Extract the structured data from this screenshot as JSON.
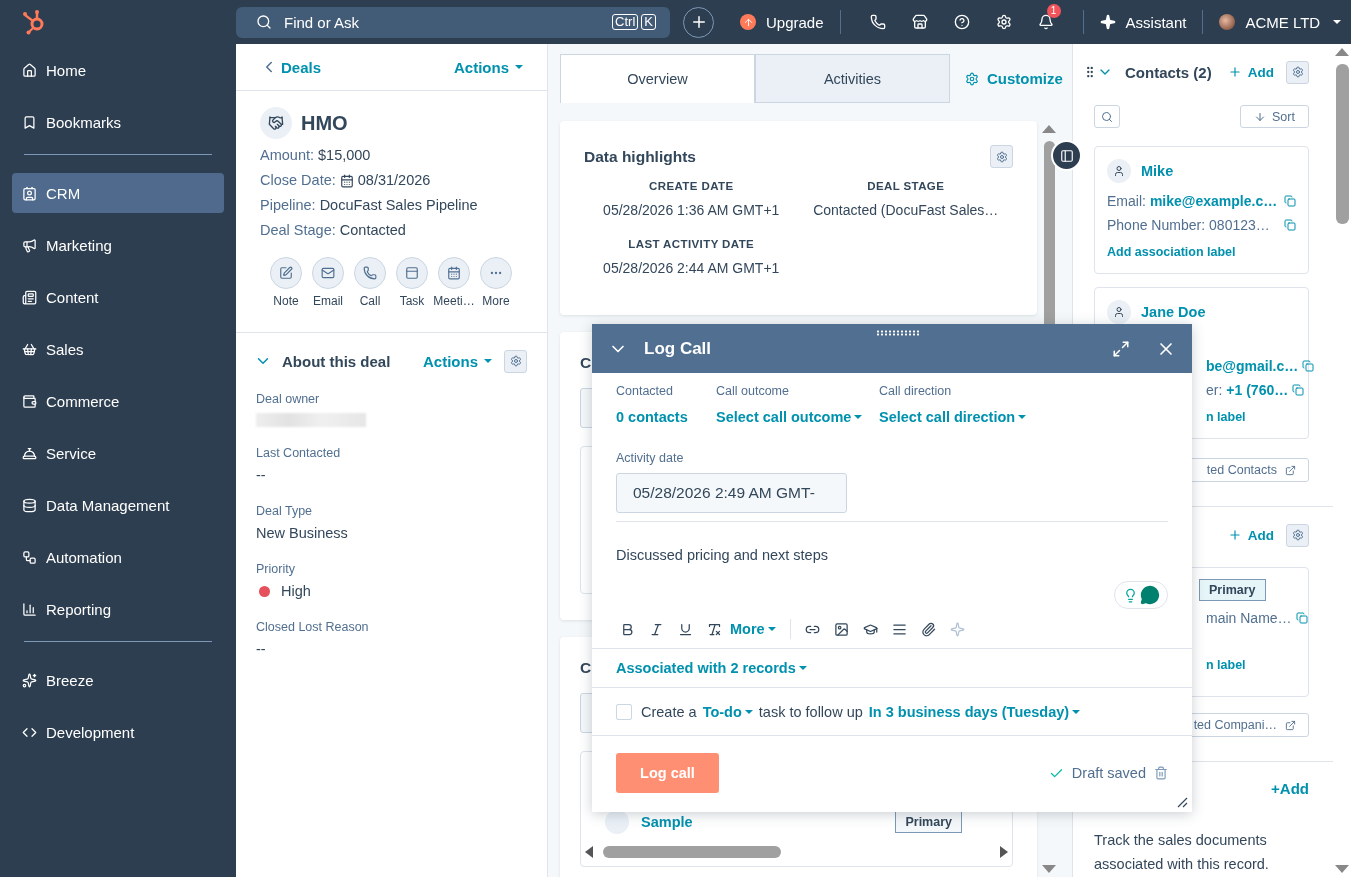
{
  "topbar": {
    "search": {
      "placeholder": "Find or Ask",
      "shortcut": [
        "Ctrl",
        "K"
      ]
    },
    "upgrade": "Upgrade",
    "notifications_badge": "1",
    "assistant": "Assistant",
    "account": "ACME LTD"
  },
  "sidebar": {
    "groups": [
      [
        {
          "label": "Home",
          "selected": false
        },
        {
          "label": "Bookmarks",
          "selected": false
        }
      ],
      [
        {
          "label": "CRM",
          "selected": true
        },
        {
          "label": "Marketing",
          "selected": false
        },
        {
          "label": "Content",
          "selected": false
        },
        {
          "label": "Sales",
          "selected": false
        },
        {
          "label": "Commerce",
          "selected": false
        },
        {
          "label": "Service",
          "selected": false
        },
        {
          "label": "Data Management",
          "selected": false
        },
        {
          "label": "Automation",
          "selected": false
        },
        {
          "label": "Reporting",
          "selected": false
        }
      ],
      [
        {
          "label": "Breeze",
          "selected": false
        },
        {
          "label": "Development",
          "selected": false
        }
      ]
    ]
  },
  "record_panel": {
    "back": "Deals",
    "actions": "Actions",
    "name": "HMO",
    "properties": [
      {
        "label": "Amount:",
        "value": "$15,000",
        "kind": "text"
      },
      {
        "label": "Close Date:",
        "value": "08/31/2026",
        "kind": "date"
      },
      {
        "label": "Pipeline:",
        "value": "DocuFast Sales Pipeline",
        "kind": "text"
      },
      {
        "label": "Deal Stage:",
        "value": "Contacted",
        "kind": "text"
      }
    ],
    "activity_buttons": [
      "Note",
      "Email",
      "Call",
      "Task",
      "Meeti…",
      "More"
    ],
    "about": {
      "title": "About this deal",
      "actions": "Actions",
      "expanded": true,
      "fields": [
        {
          "label": "Deal owner",
          "kind": "redacted"
        },
        {
          "label": "Last Contacted",
          "value": "--",
          "kind": "text"
        },
        {
          "label": "Deal Type",
          "value": "New Business",
          "kind": "text"
        },
        {
          "label": "Priority",
          "value": "High",
          "kind": "status",
          "color": "#e5505a"
        },
        {
          "label": "Closed Lost Reason",
          "value": "--",
          "kind": "text"
        }
      ]
    }
  },
  "middle": {
    "tabs": [
      {
        "label": "Overview",
        "selected": true
      },
      {
        "label": "Activities",
        "selected": false
      }
    ],
    "customize": "Customize",
    "highlights": {
      "title": "Data highlights",
      "items": [
        {
          "label": "CREATE DATE",
          "value": "05/28/2026 1:36 AM GMT+1"
        },
        {
          "label": "DEAL STAGE",
          "value": "Contacted (DocuFast Sales…"
        },
        {
          "label": "LAST ACTIVITY DATE",
          "value": "05/28/2026 2:44 AM GMT+1"
        }
      ]
    },
    "cards": [
      {
        "title": "C"
      },
      {
        "title": "C",
        "rows": [
          {
            "name": "Sample",
            "tag": "Primary"
          }
        ]
      }
    ]
  },
  "right": {
    "contacts": {
      "title": "Contacts (2)",
      "add": "Add",
      "sort": "Sort",
      "cards": [
        {
          "name": "Mike",
          "partly_hidden": false,
          "lines": [
            {
              "label": "Email:",
              "value": "mike@example.c…",
              "plain": false
            },
            {
              "label": "Phone Number:",
              "value": "080123…",
              "plain": true
            }
          ],
          "association": "Add association label"
        },
        {
          "name": "Jane Doe",
          "partly_hidden": true,
          "lines": [
            {
              "value": "be@gmail.c…",
              "plain": false
            },
            {
              "label": "er:",
              "value": "+1 (760…",
              "plain": false
            }
          ],
          "association": "n label"
        }
      ],
      "view_all": "ted Contacts"
    },
    "companies": {
      "add": "Add",
      "card": {
        "tag": "Primary",
        "lines": [
          {
            "value": "main Name…",
            "plain": true
          }
        ],
        "association": "n label"
      },
      "view_all": "ted Compani…"
    },
    "documents": {
      "add": "+Add",
      "description": "Track the sales documents associated with this record."
    }
  },
  "dialog": {
    "title": "Log Call",
    "fields": [
      {
        "label": "Contacted",
        "value": "0 contacts",
        "dropdown": false
      },
      {
        "label": "Call outcome",
        "value": "Select call outcome",
        "dropdown": true
      },
      {
        "label": "Call direction",
        "value": "Select call direction",
        "dropdown": true
      }
    ],
    "activity_date": {
      "label": "Activity date",
      "value": "05/28/2026 2:49 AM GMT-"
    },
    "body": "Discussed pricing and next steps",
    "toolbar_more": "More",
    "associated": "Associated with 2 records",
    "followup": {
      "checked": false,
      "prefix": "Create a",
      "task_type": "To-do",
      "middle": "task to follow up",
      "due": "In 3 business days (Tuesday)"
    },
    "submit": "Log call",
    "draft_status": "Draft saved"
  }
}
